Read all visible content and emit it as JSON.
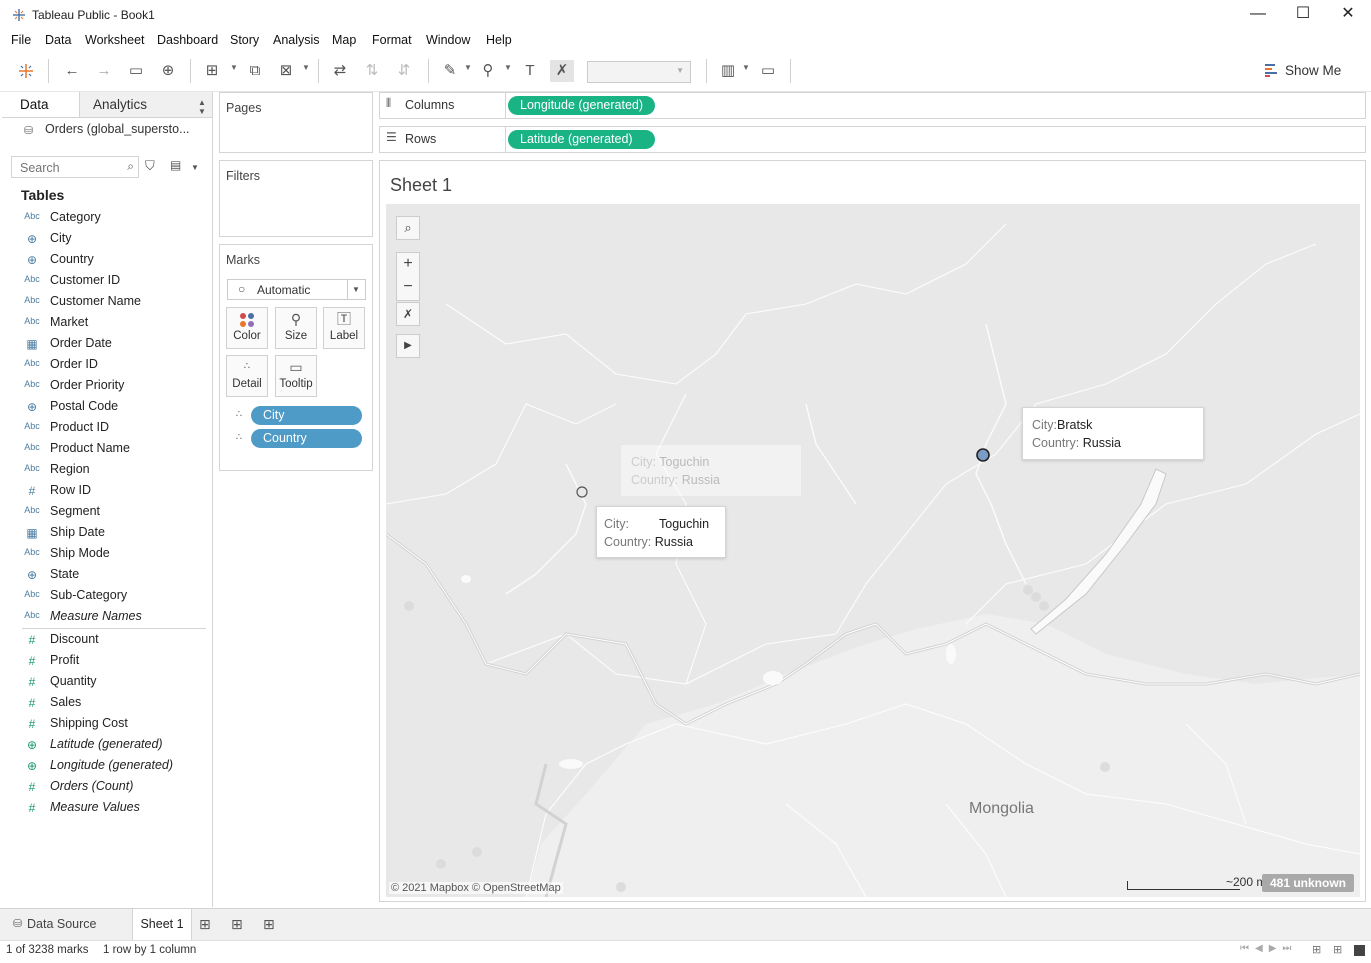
{
  "window": {
    "title": "Tableau Public - Book1",
    "minimize": "—",
    "maximize": "☐",
    "close": "✕"
  },
  "menu": [
    "File",
    "Data",
    "Worksheet",
    "Dashboard",
    "Story",
    "Analysis",
    "Map",
    "Format",
    "Window",
    "Help"
  ],
  "toolbar": {
    "show_me": "Show Me",
    "fit_value": ""
  },
  "left_panel": {
    "tab_data": "Data",
    "tab_analytics": "Analytics",
    "datasource": "Orders (global_supersto...",
    "search_placeholder": "Search",
    "tables_heading": "Tables",
    "dimensions": [
      {
        "icon": "Abc",
        "label": "Category"
      },
      {
        "icon": "globe",
        "label": "City"
      },
      {
        "icon": "globe",
        "label": "Country"
      },
      {
        "icon": "Abc",
        "label": "Customer ID"
      },
      {
        "icon": "Abc",
        "label": "Customer Name"
      },
      {
        "icon": "Abc",
        "label": "Market"
      },
      {
        "icon": "calendar",
        "label": "Order Date"
      },
      {
        "icon": "Abc",
        "label": "Order ID"
      },
      {
        "icon": "Abc",
        "label": "Order Priority"
      },
      {
        "icon": "globe",
        "label": "Postal Code"
      },
      {
        "icon": "Abc",
        "label": "Product ID"
      },
      {
        "icon": "Abc",
        "label": "Product Name"
      },
      {
        "icon": "Abc",
        "label": "Region"
      },
      {
        "icon": "#",
        "label": "Row ID"
      },
      {
        "icon": "Abc",
        "label": "Segment"
      },
      {
        "icon": "calendar",
        "label": "Ship Date"
      },
      {
        "icon": "Abc",
        "label": "Ship Mode"
      },
      {
        "icon": "globe",
        "label": "State"
      },
      {
        "icon": "Abc",
        "label": "Sub-Category"
      },
      {
        "icon": "Abc",
        "label": "Measure Names",
        "italic": true
      }
    ],
    "measures": [
      {
        "icon": "#",
        "label": "Discount"
      },
      {
        "icon": "#",
        "label": "Profit"
      },
      {
        "icon": "#",
        "label": "Quantity"
      },
      {
        "icon": "#",
        "label": "Sales"
      },
      {
        "icon": "#",
        "label": "Shipping Cost"
      },
      {
        "icon": "globe",
        "label": "Latitude (generated)",
        "italic": true
      },
      {
        "icon": "globe",
        "label": "Longitude (generated)",
        "italic": true
      },
      {
        "icon": "#",
        "label": "Orders (Count)",
        "italic": true
      },
      {
        "icon": "#",
        "label": "Measure Values",
        "italic": true
      }
    ]
  },
  "cards": {
    "pages": "Pages",
    "filters": "Filters",
    "marks": "Marks",
    "mark_type": "Automatic",
    "color": "Color",
    "size": "Size",
    "label": "Label",
    "detail": "Detail",
    "tooltip": "Tooltip",
    "pill_city": "City",
    "pill_country": "Country"
  },
  "shelves": {
    "columns_label": "Columns",
    "columns_pill": "Longitude (generated)",
    "rows_label": "Rows",
    "rows_pill": "Latitude (generated)"
  },
  "sheet": {
    "title": "Sheet 1",
    "country_label": "Mongolia",
    "attribution": "© 2021 Mapbox © OpenStreetMap",
    "scale": "~200 mi",
    "unknown": "481 unknown",
    "tooltips": {
      "bratsk": {
        "city_key": "City:",
        "city": "Bratsk",
        "country_key": "Country:",
        "country": "Russia"
      },
      "toguchin": {
        "city_key": "City:",
        "city": "Toguchin",
        "country_key": "Country:",
        "country": "Russia"
      },
      "toguchin_ghost": {
        "city_key": "City:",
        "city": "Toguchin",
        "country_key": "Country:",
        "country": "Russia"
      }
    }
  },
  "bottom": {
    "data_source": "Data Source",
    "sheet_tab": "Sheet 1",
    "status_marks": "1 of 3238 marks",
    "status_rows": "1 row by 1 column"
  }
}
